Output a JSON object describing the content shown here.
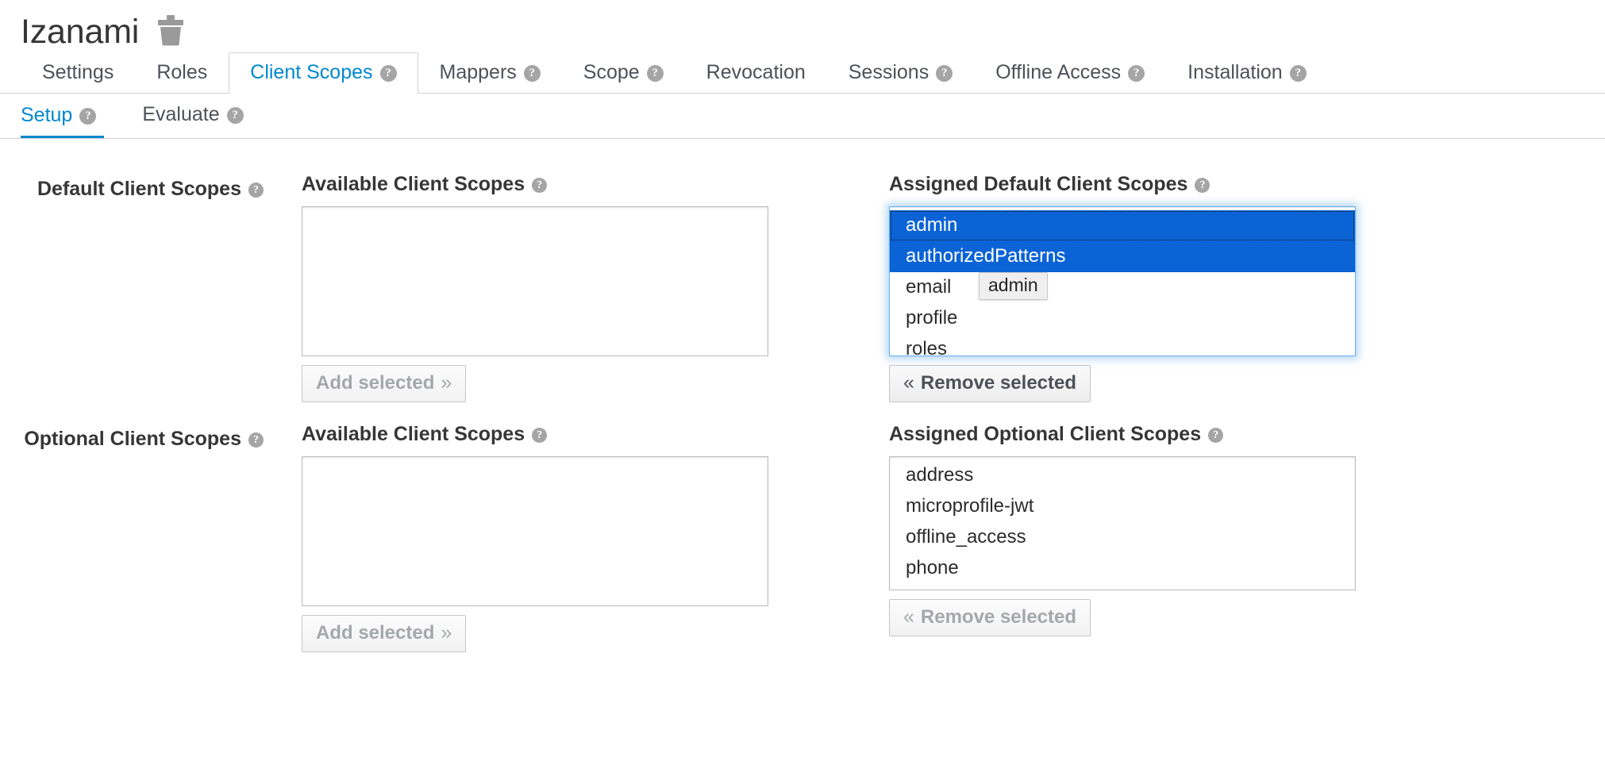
{
  "header": {
    "title": "Izanami",
    "delete_icon": "trash-icon"
  },
  "tabs": [
    {
      "label": "Settings",
      "help": false,
      "active": false
    },
    {
      "label": "Roles",
      "help": false,
      "active": false
    },
    {
      "label": "Client Scopes",
      "help": true,
      "active": true
    },
    {
      "label": "Mappers",
      "help": true,
      "active": false
    },
    {
      "label": "Scope",
      "help": true,
      "active": false
    },
    {
      "label": "Revocation",
      "help": false,
      "active": false
    },
    {
      "label": "Sessions",
      "help": true,
      "active": false
    },
    {
      "label": "Offline Access",
      "help": true,
      "active": false
    },
    {
      "label": "Installation",
      "help": true,
      "active": false
    }
  ],
  "subtabs": [
    {
      "label": "Setup",
      "help": true,
      "active": true
    },
    {
      "label": "Evaluate",
      "help": true,
      "active": false
    }
  ],
  "help_glyph": "?",
  "sections": [
    {
      "row_label": "Default Client Scopes",
      "available": {
        "title": "Available Client Scopes",
        "options": [],
        "button": {
          "label": "Add selected",
          "chevron": "»",
          "disabled": true
        }
      },
      "assigned": {
        "title": "Assigned Default Client Scopes",
        "focused": true,
        "options": [
          {
            "label": "admin",
            "selected": true,
            "focus_ring": true
          },
          {
            "label": "authorizedPatterns",
            "selected": true,
            "focus_ring": false
          },
          {
            "label": "email",
            "selected": false,
            "focus_ring": false
          },
          {
            "label": "profile",
            "selected": false,
            "focus_ring": false
          },
          {
            "label": "roles",
            "selected": false,
            "focus_ring": false
          }
        ],
        "drag_ghost": {
          "label": "admin",
          "visible": true
        },
        "button": {
          "label": "Remove selected",
          "chevron": "«",
          "disabled": false
        }
      }
    },
    {
      "row_label": "Optional Client Scopes",
      "available": {
        "title": "Available Client Scopes",
        "options": [],
        "button": {
          "label": "Add selected",
          "chevron": "»",
          "disabled": true
        }
      },
      "assigned": {
        "title": "Assigned Optional Client Scopes",
        "focused": false,
        "options": [
          {
            "label": "address",
            "selected": false,
            "focus_ring": false
          },
          {
            "label": "microprofile-jwt",
            "selected": false,
            "focus_ring": false
          },
          {
            "label": "offline_access",
            "selected": false,
            "focus_ring": false
          },
          {
            "label": "phone",
            "selected": false,
            "focus_ring": false
          }
        ],
        "drag_ghost": {
          "label": "",
          "visible": false
        },
        "button": {
          "label": "Remove selected",
          "chevron": "«",
          "disabled": true
        }
      }
    }
  ],
  "colors": {
    "accent_blue": "#0088ce",
    "selection_blue": "#0b63d6",
    "text_dark": "#363636",
    "text_muted": "#4d5258",
    "border_gray": "#d1d1d1",
    "focus_blue": "#66afe9"
  }
}
